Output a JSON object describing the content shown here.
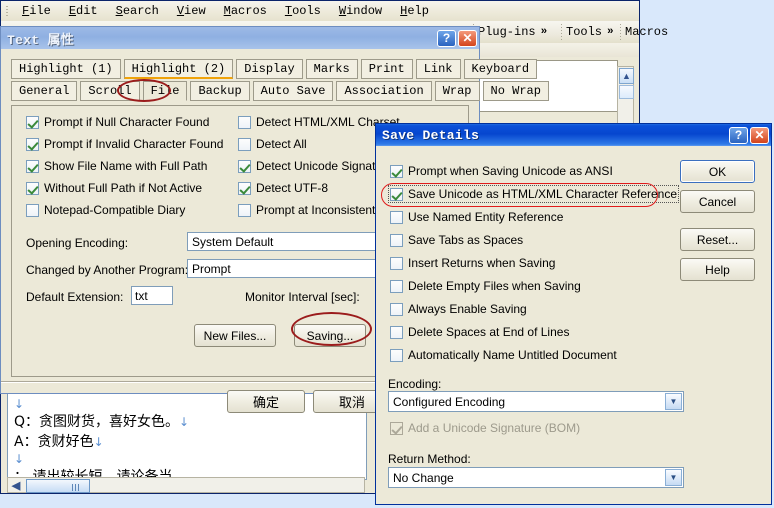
{
  "menubar": {
    "items": [
      "File",
      "Edit",
      "Search",
      "View",
      "Macros",
      "Tools",
      "Window",
      "Help"
    ]
  },
  "toolbar": {
    "items": [
      "Plug-ins",
      "Tools",
      "Macros"
    ],
    "overflow_glyph": "»"
  },
  "editor": {
    "lines": [
      {
        "text": "",
        "pilcrow": "↓"
      },
      {
        "text": "Q：贪图财货，喜好女色。",
        "pilcrow": "↓"
      },
      {
        "text": "A：贪财好色",
        "pilcrow": "↓"
      },
      {
        "text": "",
        "pilcrow": "↓"
      },
      {
        "text": "：  请出较长短，请论备当",
        "pilcrow": ""
      }
    ]
  },
  "text_dialog": {
    "title": "Text 属性",
    "help_button": "?",
    "close_button": "✕",
    "tabs_row1": [
      "Highlight (1)",
      "Highlight (2)",
      "Display",
      "Marks",
      "Print",
      "Link",
      "Keyboard"
    ],
    "tabs_row2": [
      "General",
      "Scroll",
      "File",
      "Backup",
      "Auto Save",
      "Association",
      "Wrap",
      "No Wrap"
    ],
    "active_tab": "File",
    "hot_tab": "Highlight (2)",
    "checkboxes_left": [
      {
        "label": "Prompt if Null Character Found",
        "checked": true
      },
      {
        "label": "Prompt if Invalid Character Found",
        "checked": true
      },
      {
        "label": "Show File Name with Full Path",
        "checked": true
      },
      {
        "label": "Without Full Path if Not Active",
        "checked": true
      },
      {
        "label": "Notepad-Compatible Diary",
        "checked": false
      }
    ],
    "checkboxes_right": [
      {
        "label": "Detect HTML/XML Charset",
        "checked": false
      },
      {
        "label": "Detect All",
        "checked": false
      },
      {
        "label": "Detect Unicode Signature",
        "checked": true
      },
      {
        "label": "Detect UTF-8",
        "checked": true
      },
      {
        "label": "Prompt at Inconsistent Return",
        "checked": false
      }
    ],
    "fields": [
      {
        "label": "Opening Encoding:",
        "value": "System Default"
      },
      {
        "label": "Changed by Another Program:",
        "value": "Prompt"
      }
    ],
    "default_extension_label": "Default Extension:",
    "default_extension_value": "txt",
    "monitor_interval_label": "Monitor Interval [sec]:",
    "buttons": {
      "new_files": "New Files...",
      "saving": "Saving...",
      "ok": "确定",
      "cancel": "取消"
    }
  },
  "save_dialog": {
    "title": "Save Details",
    "help_button": "?",
    "close_button": "✕",
    "checkboxes": [
      {
        "label": "Prompt when Saving Unicode as ANSI",
        "checked": true,
        "disabled": false,
        "highlighted": false
      },
      {
        "label": "Save Unicode as HTML/XML Character Reference",
        "checked": true,
        "disabled": false,
        "highlighted": true
      },
      {
        "label": "Use Named Entity Reference",
        "checked": false,
        "disabled": false,
        "highlighted": false
      },
      {
        "label": "Save Tabs as Spaces",
        "checked": false,
        "disabled": false,
        "highlighted": false
      },
      {
        "label": "Insert Returns when Saving",
        "checked": false,
        "disabled": false,
        "highlighted": false
      },
      {
        "label": "Delete Empty Files when Saving",
        "checked": false,
        "disabled": false,
        "highlighted": false
      },
      {
        "label": "Always Enable Saving",
        "checked": false,
        "disabled": false,
        "highlighted": false
      },
      {
        "label": "Delete Spaces at End of Lines",
        "checked": false,
        "disabled": false,
        "highlighted": false
      },
      {
        "label": "Automatically Name Untitled Document",
        "checked": false,
        "disabled": false,
        "highlighted": false
      }
    ],
    "encoding_label": "Encoding:",
    "encoding_value": "Configured Encoding",
    "bom_checkbox": {
      "label": "Add a Unicode Signature (BOM)",
      "checked": true,
      "disabled": true
    },
    "return_method_label": "Return Method:",
    "return_method_value": "No Change",
    "buttons": {
      "ok": "OK",
      "cancel": "Cancel",
      "reset": "Reset...",
      "help": "Help"
    }
  },
  "colors": {
    "desktop": "#d9e8fb",
    "dialog_face": "#ece9d8",
    "active_title": "#0b50d8",
    "inactive_title": "#9db9e6",
    "annotation_red": "#9b1c1c",
    "highlight_red": "#e01b1b",
    "hot_tab_underline": "#f0a30a",
    "check_green": "#3a8a3a"
  }
}
